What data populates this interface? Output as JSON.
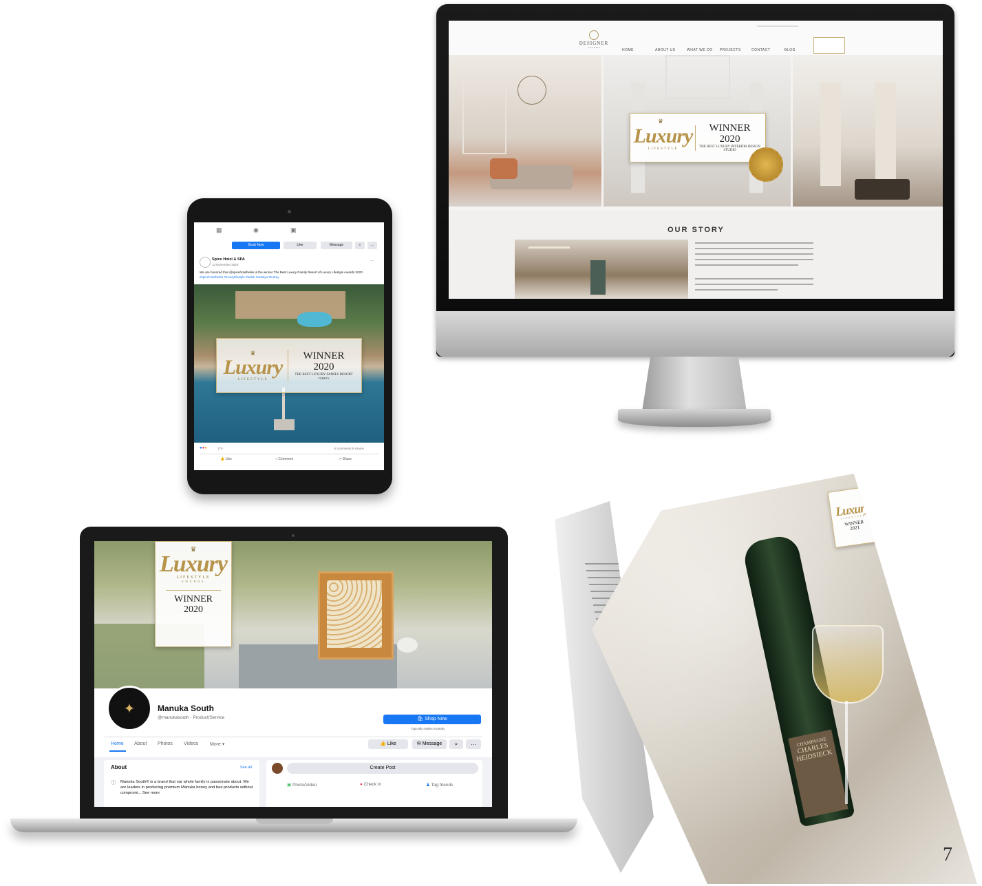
{
  "page_number": "7",
  "colors": {
    "gold": "#b7934a",
    "facebook_blue": "#1877f2",
    "sea_blue": "#2a6f90"
  },
  "award": {
    "script": "Luxury",
    "sub": "LIFESTYLE",
    "sub2": "AWARDS",
    "winner": "WINNER",
    "year_2020": "2020",
    "year_2021": "2021",
    "desktop_desc": "THE BEST LUXURY INTERIOR DESIGN STUDIO",
    "tablet_desc": "THE BEST LUXURY FAMILY RESORT",
    "tablet_country": "TURKEY"
  },
  "desktop_site": {
    "logo": "DESIGNER",
    "logo_sub": "L E L A & S",
    "nav": [
      "HOME",
      "ABOUT US",
      "WHAT WE DO",
      "PROJECTS",
      "CONTACT",
      "BLOG"
    ],
    "section_title": "OUR STORY"
  },
  "tablet_fb": {
    "book_now": "Book Now",
    "like": "Like",
    "message": "Message",
    "page_name": "Spice Hotel & SPA",
    "post_date": "13 November 2020",
    "post_text": "We are honored that @spicehotelbelek is the winner The Best Luxury Family Resort of Luxury Lifestyle Awards 2020",
    "hashtags": "#spicehotelbelek #luxurylifestyle #belek #antalya #turkey",
    "reactions": "170",
    "comments_shares": "8 comments  8 shares",
    "actions": [
      "Like",
      "Comment",
      "Share"
    ]
  },
  "laptop_fb": {
    "page_name": "Manuka South",
    "handle": "@manukasouth · Product/Service",
    "shop_now": "Shop Now",
    "shop_sub": "Typically replies instantly",
    "tabs": [
      "Home",
      "About",
      "Photos",
      "Videos",
      "More"
    ],
    "like": "Like",
    "message": "Message",
    "about_title": "About",
    "see_all": "See all",
    "about_text": "Manuka South® is a brand that our whole family is passionate about. We are leaders in producing premium Manuka honey and bee products without compromi... See more",
    "create_post": "Create Post",
    "post_actions": [
      "Photo/Video",
      "Check in",
      "Tag friends"
    ]
  },
  "magazine": {
    "bottle_label_1": "CHAMPAGNE",
    "bottle_label_2": "CHARLES",
    "bottle_label_3": "HEIDSIECK"
  }
}
